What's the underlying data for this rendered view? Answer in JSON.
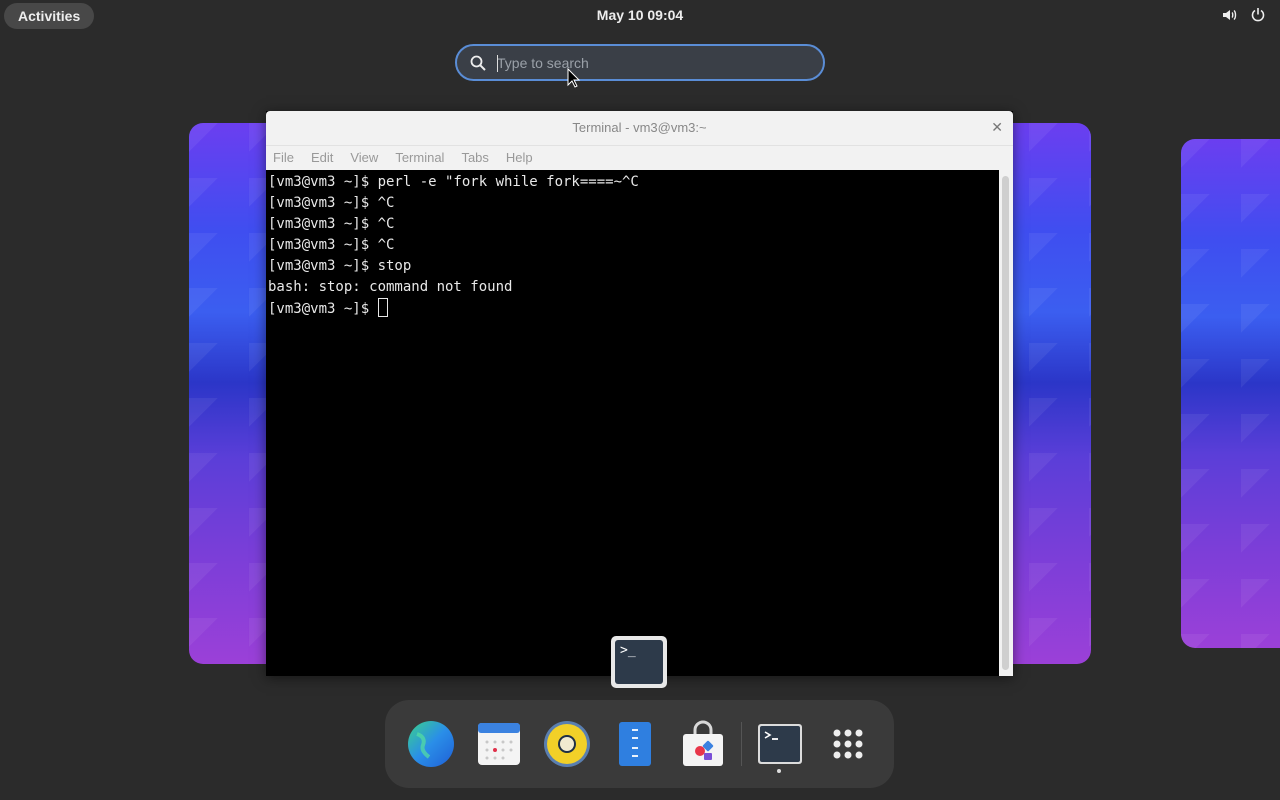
{
  "topbar": {
    "activities_label": "Activities",
    "clock": "May 10  09:04",
    "icons": [
      "volume-icon",
      "power-icon"
    ]
  },
  "search": {
    "placeholder": "Type to search",
    "value": ""
  },
  "window": {
    "title": "Terminal - vm3@vm3:~",
    "menu": [
      "File",
      "Edit",
      "View",
      "Terminal",
      "Tabs",
      "Help"
    ],
    "lines": [
      "[vm3@vm3 ~]$ perl -e \"fork while fork====~^C",
      "[vm3@vm3 ~]$ ^C",
      "[vm3@vm3 ~]$ ^C",
      "[vm3@vm3 ~]$ ^C",
      "[vm3@vm3 ~]$ stop",
      "bash: stop: command not found"
    ],
    "prompt": "[vm3@vm3 ~]$ "
  },
  "dock": {
    "apps": [
      "web-browser-icon",
      "calendar-icon",
      "music-player-icon",
      "text-editor-icon",
      "software-store-icon",
      "terminal-icon",
      "app-grid-icon"
    ],
    "terminal_badge_text": ">_"
  },
  "colors": {
    "accent": "#5a8dd6",
    "panel": "#2b2b2b",
    "dock": "#3a3a3a"
  }
}
